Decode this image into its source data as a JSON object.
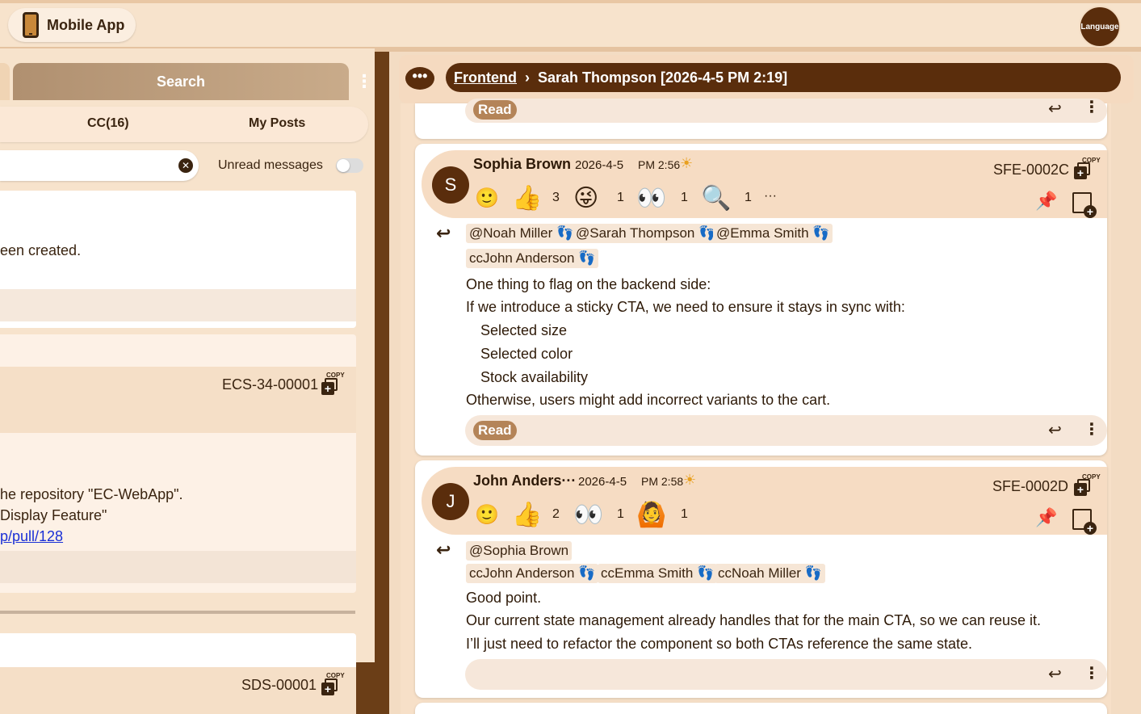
{
  "topbar": {
    "app_label": "Mobile App",
    "language_label": "Language"
  },
  "left": {
    "search_tab": "Search",
    "subtabs": {
      "cc": "CC(16)",
      "my_posts": "My Posts"
    },
    "unread_label": "Unread messages",
    "card1": {
      "text": "een created."
    },
    "card2": {
      "code": "ECS-34-00001",
      "copy": "COPY",
      "line1": "he repository \"EC-WebApp\".",
      "line2": "Display Feature\"",
      "link": "p/pull/128"
    },
    "card3": {
      "code": "SDS-00001",
      "copy": "COPY"
    }
  },
  "breadcrumb": {
    "root": "Frontend",
    "current": "Sarah Thompson [2026-4-5 PM 2:19]"
  },
  "messages": [
    {
      "read_label": "Read"
    },
    {
      "avatar": "S",
      "name": "Sophia Brown",
      "date": "2026-4-5",
      "time": "PM 2:56",
      "code": "SFE-0002C",
      "copy": "COPY",
      "reactions": [
        {
          "emoji": "👍",
          "count": "3"
        },
        {
          "emoji": "😜",
          "count": "1"
        },
        {
          "emoji": "👀",
          "count": "1"
        },
        {
          "emoji": "🔍",
          "count": "1"
        }
      ],
      "more": "···",
      "tags": [
        "@Noah Miller",
        "@Sarah Thompson",
        "@Emma Smith",
        "ccJohn Anderson"
      ],
      "body": [
        "One thing to flag on the backend side:",
        "If we introduce a sticky CTA, we need to ensure it stays in sync with:",
        "Selected size",
        "Selected color",
        "Stock availability",
        "Otherwise, users might add incorrect variants to the cart."
      ],
      "read_label": "Read"
    },
    {
      "avatar": "J",
      "name": "John Anders···",
      "date": "2026-4-5",
      "time": "PM 2:58",
      "code": "SFE-0002D",
      "copy": "COPY",
      "reactions": [
        {
          "emoji": "👍",
          "count": "2"
        },
        {
          "emoji": "👀",
          "count": "1"
        },
        {
          "emoji": "🙆",
          "count": "1"
        }
      ],
      "tags": [
        "@Sophia Brown",
        "ccJohn Anderson",
        "ccEmma Smith",
        "ccNoah Miller"
      ],
      "body": [
        "Good point.",
        "Our current state management already handles that for the main CTA, so we can reuse it.",
        "I’ll just need to refactor the component so both CTAs reference the same state."
      ]
    }
  ],
  "icons": {
    "sun": "☀",
    "foot": "👣",
    "reply": "↩",
    "pin": "📌"
  }
}
